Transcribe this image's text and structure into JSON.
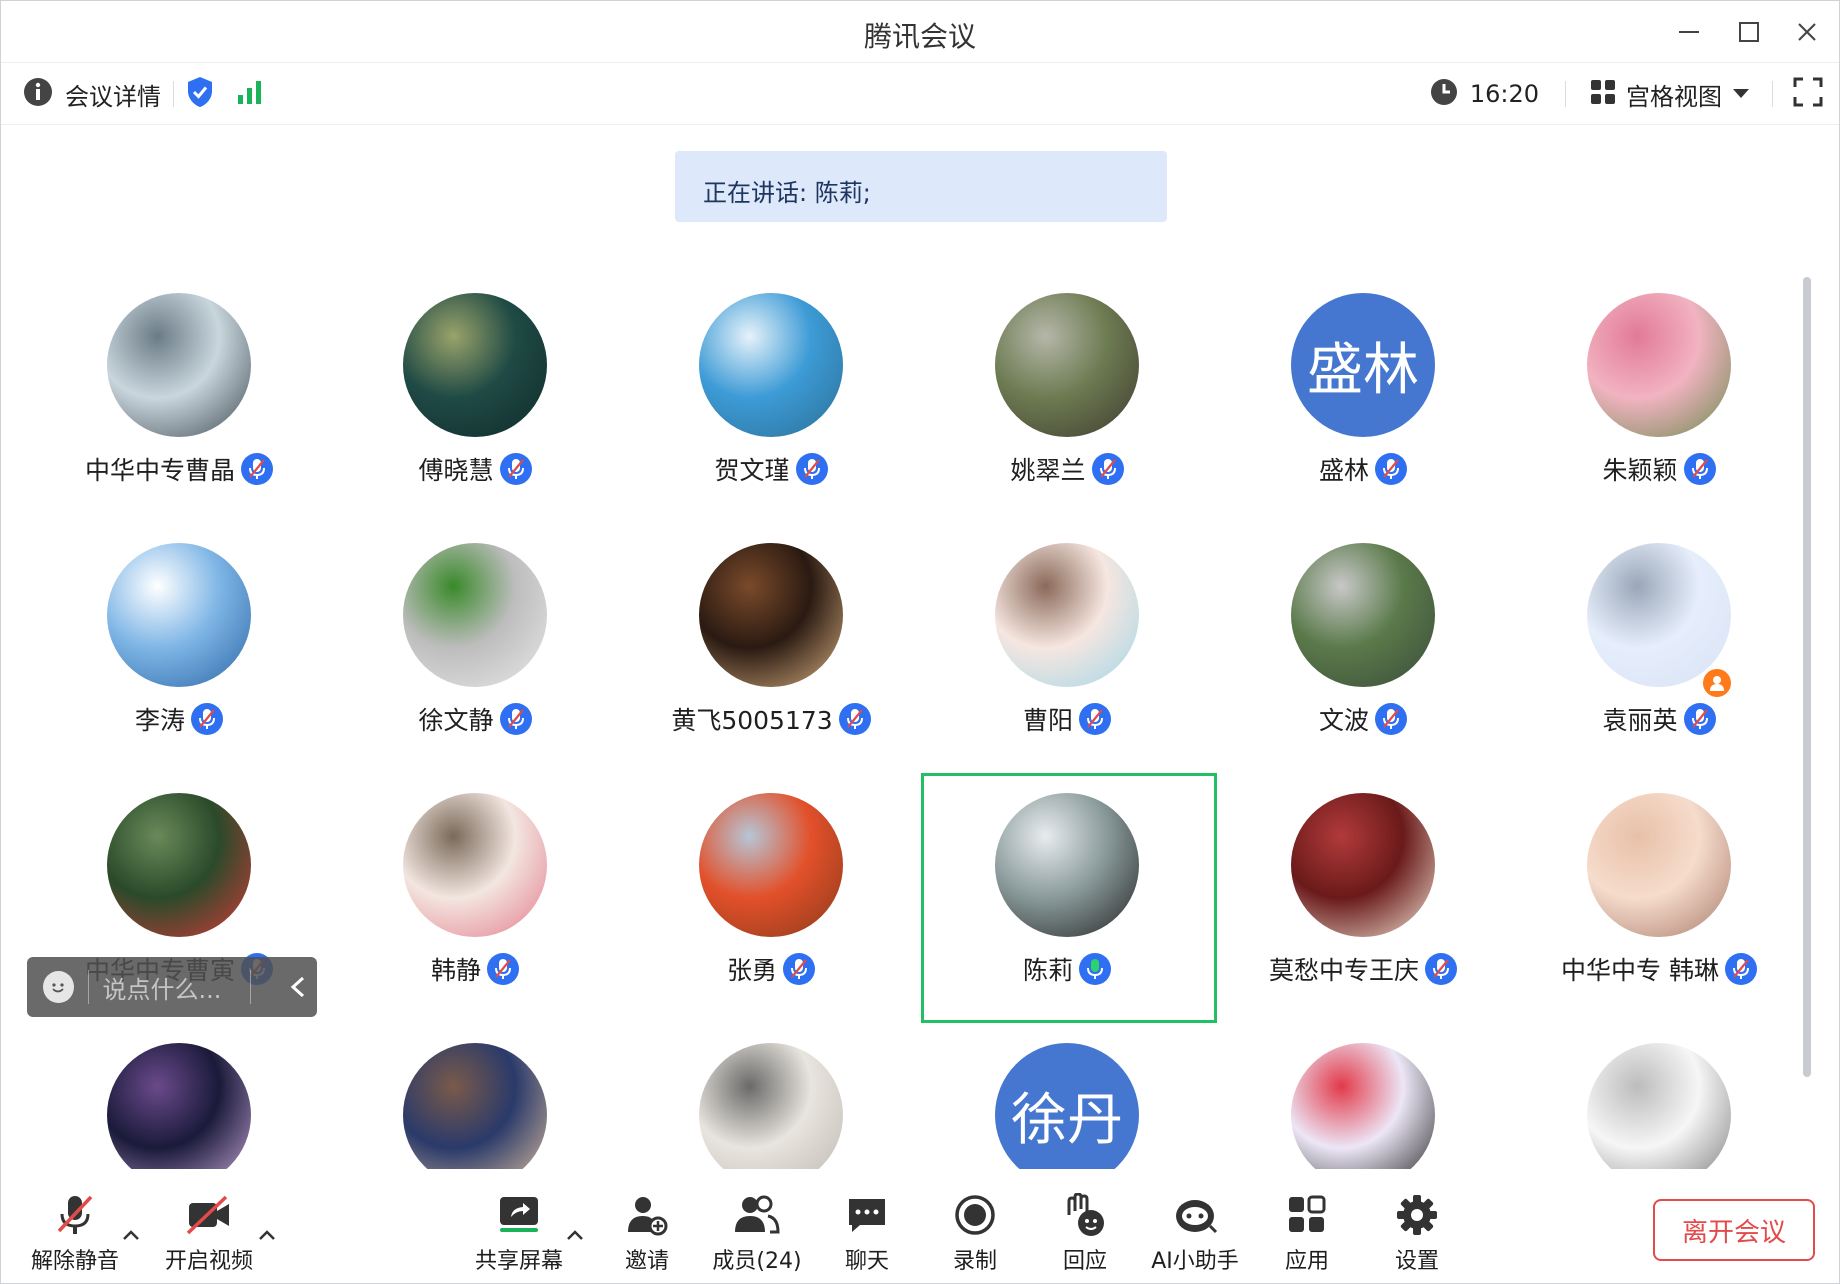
{
  "window": {
    "title": "腾讯会议"
  },
  "infobar": {
    "details_label": "会议详情",
    "time": "16:20",
    "view_label": "宫格视图"
  },
  "speaking": {
    "text": "正在讲话: 陈莉;"
  },
  "participants": [
    {
      "name": "中华中专曹晶",
      "avatar": "photo-seaside"
    },
    {
      "name": "傅晓慧",
      "avatar": "photo-floral-screen"
    },
    {
      "name": "贺文瑾",
      "avatar": "photo-pier-sky"
    },
    {
      "name": "姚翠兰",
      "avatar": "photo-woman-bridge"
    },
    {
      "name": "盛林",
      "avatar_text": "盛林"
    },
    {
      "name": "朱颖颖",
      "avatar": "photo-pink-roses"
    },
    {
      "name": "李涛",
      "avatar": "photo-smurf"
    },
    {
      "name": "徐文静",
      "avatar": "photo-clover"
    },
    {
      "name": "黄飞5005173",
      "avatar": "photo-cafe"
    },
    {
      "name": "曹阳",
      "avatar": "photo-cartoon-boy"
    },
    {
      "name": "文波",
      "avatar": "photo-walkway"
    },
    {
      "name": "袁丽英",
      "avatar": "photo-elephant-sketch",
      "host": true
    },
    {
      "name": "中华中专曹寅",
      "avatar": "photo-red-flower"
    },
    {
      "name": "韩静",
      "avatar": "photo-illustrated-girl"
    },
    {
      "name": "张勇",
      "avatar": "photo-autumn-trees"
    },
    {
      "name": "陈莉",
      "avatar": "photo-woman-lake",
      "speaking": true
    },
    {
      "name": "莫愁中专王庆",
      "avatar": "photo-red-wall"
    },
    {
      "name": "中华中专 韩琳",
      "avatar": "photo-baby-smile"
    },
    {
      "name": "",
      "avatar": "photo-planet"
    },
    {
      "name": "",
      "avatar": "photo-anime-girl"
    },
    {
      "name": "",
      "avatar": "photo-wax-seal"
    },
    {
      "name": "",
      "avatar_text": "徐丹"
    },
    {
      "name": "",
      "avatar": "photo-minnie"
    },
    {
      "name": "",
      "avatar": "photo-sketch-boy"
    }
  ],
  "chat": {
    "placeholder": "说点什么..."
  },
  "toolbar": {
    "unmute": "解除静音",
    "start_video": "开启视频",
    "share_screen": "共享屏幕",
    "invite": "邀请",
    "members": "成员(24)",
    "chat": "聊天",
    "record": "录制",
    "react": "回应",
    "ai_assistant": "AI小助手",
    "apps": "应用",
    "settings": "设置",
    "leave": "离开会议"
  },
  "colors": {
    "accent": "#2f6ff1",
    "speaking_border": "#21c063",
    "leave": "#e34a4a",
    "banner": "#dde8fb"
  }
}
